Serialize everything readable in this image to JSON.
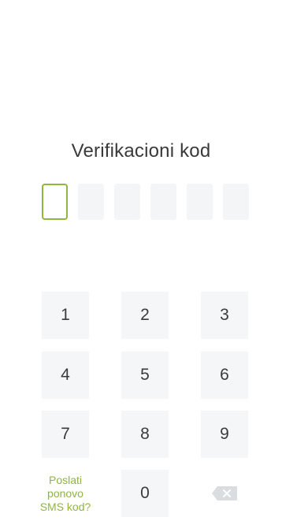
{
  "verification": {
    "title": "Verifikacioni kod",
    "code_length": 6,
    "active_index": 0
  },
  "keypad": {
    "keys": [
      "1",
      "2",
      "3",
      "4",
      "5",
      "6",
      "7",
      "8",
      "9",
      "0"
    ],
    "resend_label_lines": [
      "Poslati",
      "ponovo",
      "SMS kod?"
    ],
    "backspace_icon": "backspace-icon"
  },
  "colors": {
    "accent": "#8fb63e",
    "key_background": "#f5f6f7",
    "code_box_background": "#f4f5f6"
  }
}
